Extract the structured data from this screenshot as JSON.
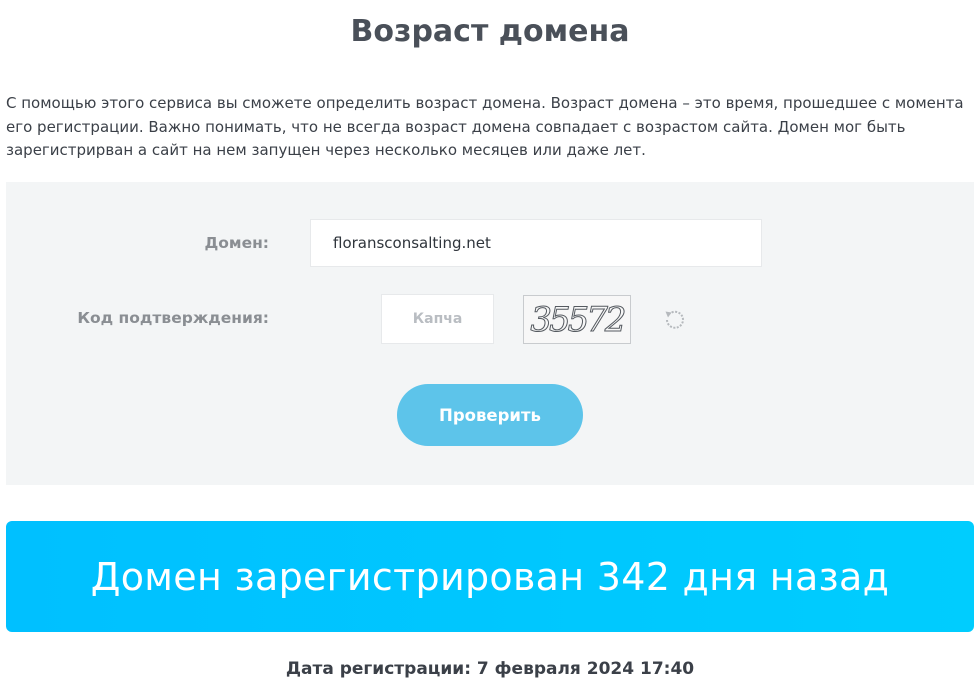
{
  "page": {
    "title": "Возраст домена",
    "intro": "С помощью этого сервиса вы сможете определить возраст домена. Возраст домена – это время, прошедшее с момента его регистрации. Важно понимать, что не всегда возраст домена совпадает с возрастом сайта. Домен мог быть зарегистрирван а сайт на нем запущен через несколько месяцев или даже лет."
  },
  "form": {
    "domain_label": "Домен:",
    "domain_value": "floransconsalting.net",
    "captcha_label": "Код подтверждения:",
    "captcha_placeholder": "Капча",
    "captcha_image_text": "35572",
    "refresh_icon": "refresh-icon",
    "submit_label": "Проверить",
    "accent_color": "#5dc4ea"
  },
  "result": {
    "banner_text": "Домен зарегистрирован 342 дня назад",
    "registration_date": "Дата регистрации: 7 февраля 2024 17:40",
    "banner_color": "#00c8ff"
  }
}
